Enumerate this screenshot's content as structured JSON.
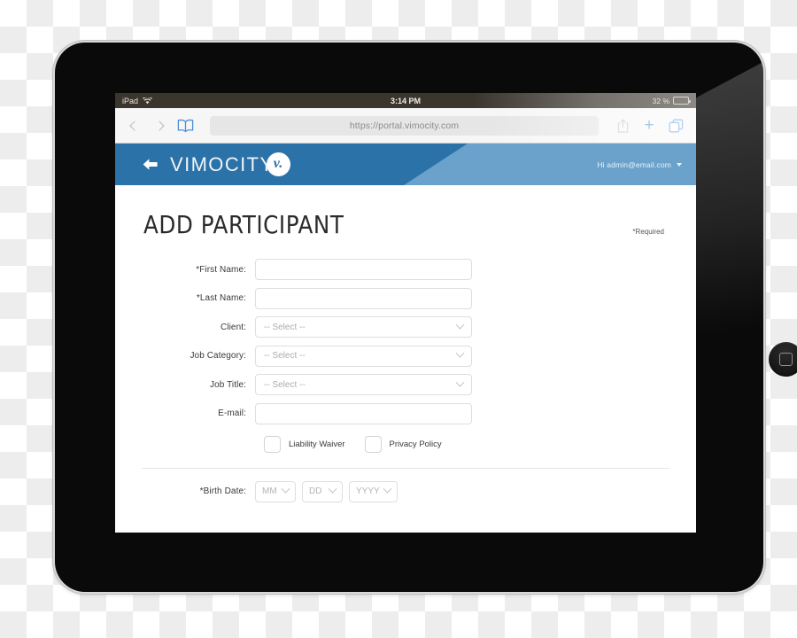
{
  "device": {
    "type": "tablet",
    "home_button": "home-button",
    "camera": "front-camera"
  },
  "status_bar": {
    "carrier": "iPad",
    "wifi_icon": "wifi-icon",
    "time": "3:14 PM",
    "battery_percent": "32 %",
    "battery_level": 32
  },
  "browser": {
    "back_icon": "chevron-left-icon",
    "forward_icon": "chevron-right-icon",
    "bookmarks_icon": "book-icon",
    "url": "https://portal.vimocity.com",
    "share_icon": "share-icon",
    "new_tab_icon": "plus-icon",
    "tabs_icon": "tabs-icon",
    "accent_color": "#4a90d9"
  },
  "app_header": {
    "back_icon": "arrow-left-icon",
    "brand_name": "VIMOCITY",
    "brand_badge": "v.",
    "user_greeting": "Hi admin@email.com",
    "dropdown_icon": "caret-down-icon",
    "primary_color": "#2a72a8",
    "secondary_color": "#6ba2cb"
  },
  "page": {
    "title": "ADD PARTICIPANT",
    "required_note": "*Required"
  },
  "form": {
    "fields": [
      {
        "label": "*First Name:",
        "type": "text",
        "value": "",
        "required": true
      },
      {
        "label": "*Last Name:",
        "type": "text",
        "value": "",
        "required": true
      },
      {
        "label": "Client:",
        "type": "select",
        "value": "-- Select --",
        "required": false
      },
      {
        "label": "Job Category:",
        "type": "select",
        "value": "-- Select --",
        "required": false
      },
      {
        "label": "Job Title:",
        "type": "select",
        "value": "-- Select --",
        "required": false
      },
      {
        "label": "E-mail:",
        "type": "text",
        "value": "",
        "required": false
      }
    ],
    "checkboxes": [
      {
        "label": "Liability Waiver",
        "checked": false
      },
      {
        "label": "Privacy Policy",
        "checked": false
      }
    ],
    "birth_date": {
      "label": "*Birth Date:",
      "month": "MM",
      "day": "DD",
      "year": "YYYY"
    }
  }
}
